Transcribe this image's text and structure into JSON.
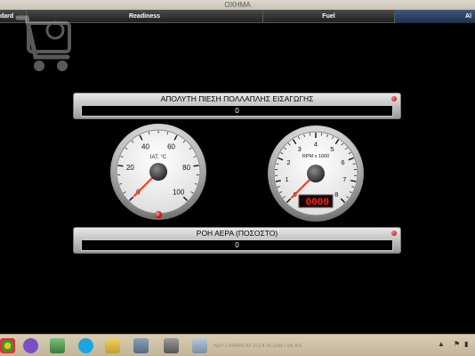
{
  "window": {
    "title": "ΟΧΗΜΑ"
  },
  "tabs": [
    {
      "label": "dard"
    },
    {
      "label": "Readiness"
    },
    {
      "label": "Fuel"
    },
    {
      "label": "Al"
    }
  ],
  "panels": {
    "map": {
      "label": "ΑΠΟΛΥΤΗ ΠΙΕΣΗ ΠΟΛΛΑΠΛΗΣ ΕΙΣΑΓΩΓΗΣ",
      "value": "0"
    },
    "air_flow": {
      "label": "ΡΟΗ ΑΕΡΑ (ΠΟΣΟΣΤΟ)",
      "value": "0"
    }
  },
  "gauges": {
    "iat": {
      "unit_label": "IAT, °C",
      "ticks": [
        "0",
        "20",
        "40",
        "60",
        "80",
        "100"
      ],
      "min": 0,
      "max": 100,
      "value": 0
    },
    "rpm": {
      "unit_label": "RPM x 1000",
      "ticks": [
        "0",
        "1",
        "2",
        "3",
        "4",
        "5",
        "6",
        "7",
        "8"
      ],
      "min": 0,
      "max": 8,
      "value": 0,
      "digital_readout": "0000"
    }
  },
  "colors": {
    "needle": "#ff3a1a",
    "led": "#e00000",
    "tab_active": "#2a4366"
  },
  "taskbar": {
    "status_text": "ΑΕΡ ΓΡΑΦΑΓΙΟ 2014 ΙΑ ΣΑΒ ΠΑΓΚΑ"
  }
}
